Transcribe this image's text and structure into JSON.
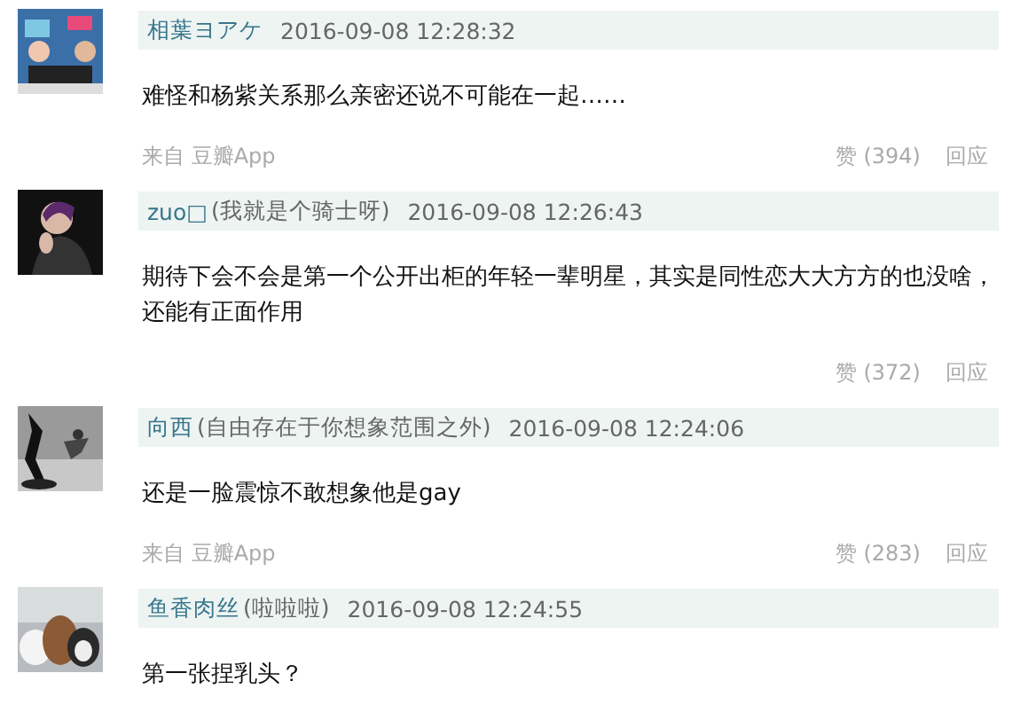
{
  "comments": [
    {
      "name": "相葉ヨアケ",
      "time": "2016-09-08 12:28:32",
      "text": "难怪和杨紫关系那么亲密还说不可能在一起……",
      "source": "来自 豆瓣App",
      "likes": "赞 (394)",
      "reply": "回应"
    },
    {
      "name": "zuo□",
      "signature": "(我就是个骑士呀)",
      "time": "2016-09-08 12:26:43",
      "text": "期待下会不会是第一个公开出柜的年轻一辈明星，其实是同性恋大大方方的也没啥，还能有正面作用",
      "likes": "赞 (372)",
      "reply": "回应"
    },
    {
      "name": "向西",
      "signature": "(自由存在于你想象范围之外)",
      "time": "2016-09-08 12:24:06",
      "text": "还是一脸震惊不敢想象他是gay",
      "source": "来自 豆瓣App",
      "likes": "赞 (283)",
      "reply": "回应"
    },
    {
      "name": "鱼香肉丝",
      "signature": "(啦啦啦)",
      "time": "2016-09-08 12:24:55",
      "text": "第一张捏乳头？"
    }
  ]
}
